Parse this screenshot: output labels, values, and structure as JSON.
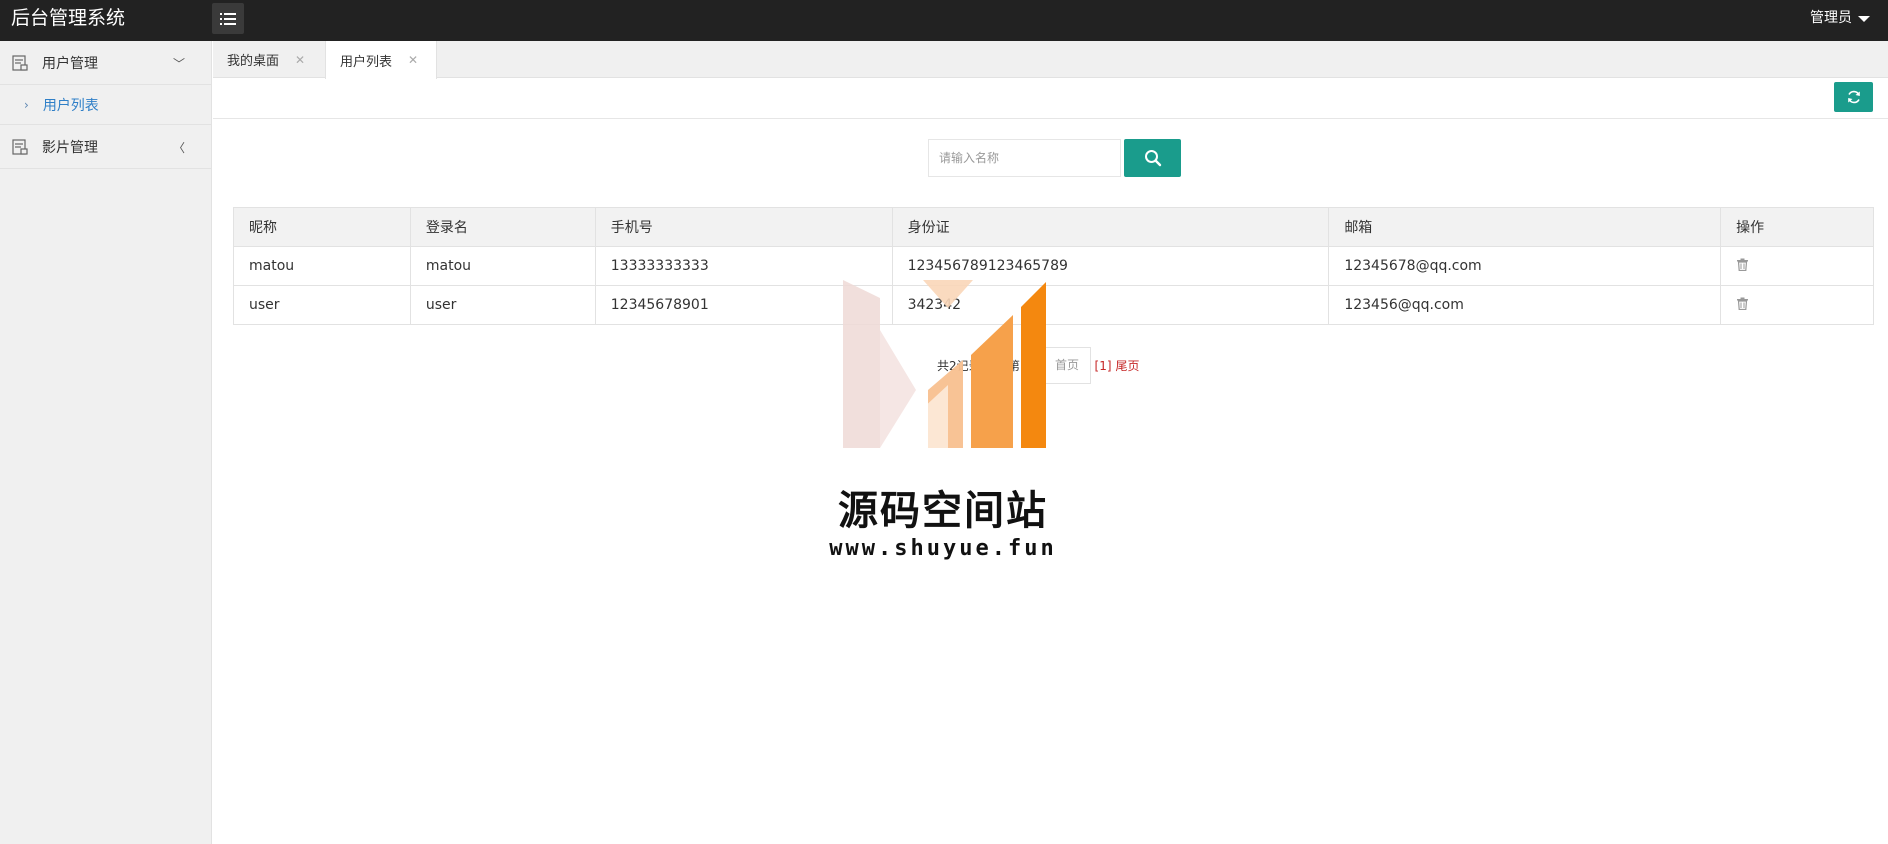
{
  "app": {
    "title": "后台管理系统",
    "user": "管理员"
  },
  "sidebar": {
    "groups": [
      {
        "label": "用户管理",
        "arrow": "﹀",
        "children": [
          {
            "label": "用户列表"
          }
        ]
      },
      {
        "label": "影片管理",
        "arrow": "〈"
      }
    ]
  },
  "tabs": [
    {
      "label": "我的桌面",
      "close": "✕"
    },
    {
      "label": "用户列表",
      "close": "✕"
    }
  ],
  "search": {
    "placeholder": "请输入名称"
  },
  "table": {
    "headers": [
      "昵称",
      "登录名",
      "手机号",
      "身份证",
      "邮箱",
      "操作"
    ],
    "rows": [
      {
        "nickname": "matou",
        "login": "matou",
        "phone": "13333333333",
        "idcard": "123456789123465789",
        "email": "12345678@qq.com"
      },
      {
        "nickname": "user",
        "login": "user",
        "phone": "12345678901",
        "idcard": "342342",
        "email": "123456@qq.com"
      }
    ]
  },
  "pagination": {
    "summary": "共2记录 1页 第1页",
    "first": "首页",
    "current": "[1]",
    "last": "尾页"
  },
  "watermark": {
    "title": "源码空间站",
    "url": "www.shuyue.fun"
  },
  "colors": {
    "topbar": "#222222",
    "accent": "#1a9c8c",
    "link": "#2f7fc7",
    "pager_red": "#c62828"
  },
  "icons": {
    "menu": "menu-icon",
    "refresh": "refresh-icon",
    "search": "search-icon",
    "delete": "trash-icon"
  }
}
